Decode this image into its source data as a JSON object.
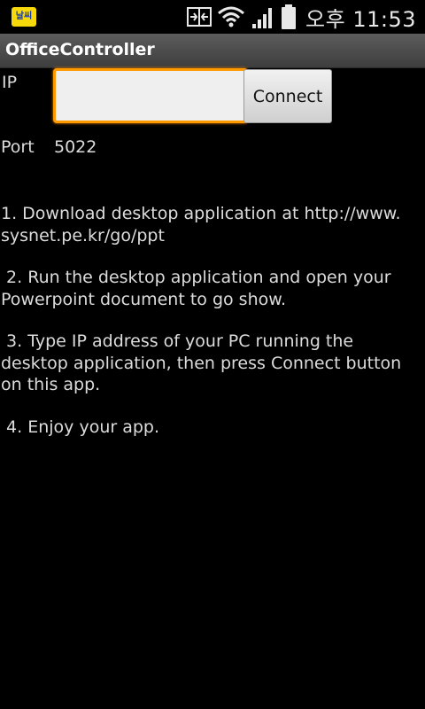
{
  "status_bar": {
    "notification_text": "날씨",
    "time": "오후 11:53"
  },
  "app": {
    "title": "OfficeController"
  },
  "form": {
    "ip_label": "IP",
    "ip_value": "",
    "connect_label": "Connect",
    "port_label": "Port",
    "port_value": "5022"
  },
  "instructions": [
    "1. Download desktop application at http://www.\nsysnet.pe.kr/go/ppt",
    " 2. Run the desktop application and open your\nPowerpoint document to go show.",
    " 3. Type IP address of your PC running the\ndesktop application, then press Connect button\non this app.",
    " 4. Enjoy your app."
  ],
  "colors": {
    "focus_accent": "#ff9900",
    "text": "#dcdcdc",
    "background": "#000000"
  }
}
